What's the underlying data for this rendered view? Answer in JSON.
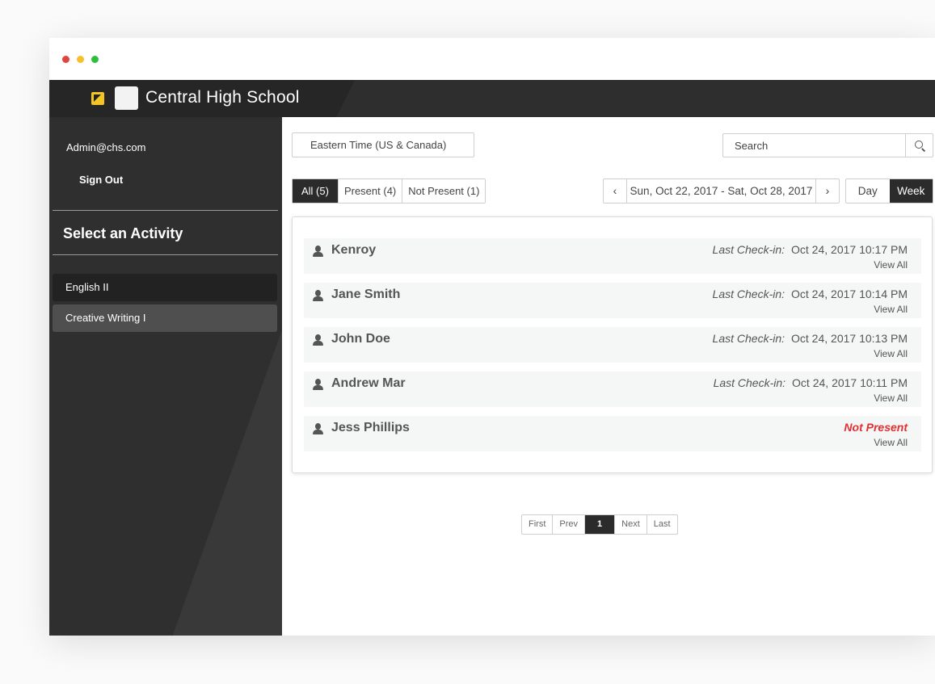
{
  "brand": {
    "title": "Central High School"
  },
  "sidebar": {
    "email": "Admin@chs.com",
    "sign_out": "Sign Out",
    "heading": "Select an Activity",
    "items": [
      {
        "label": "English II"
      },
      {
        "label": "Creative Writing I"
      }
    ]
  },
  "toolbar": {
    "timezone": "Eastern Time (US & Canada)",
    "search_placeholder": "Search",
    "filters": [
      {
        "label": "All (5)"
      },
      {
        "label": "Present (4)"
      },
      {
        "label": "Not Present (1)"
      }
    ],
    "date_range": "Sun, Oct 22, 2017 - Sat, Oct 28, 2017",
    "prev_glyph": "‹",
    "next_glyph": "›",
    "view_day": "Day",
    "view_week": "Week"
  },
  "attendance": [
    {
      "name": "Kenroy",
      "status_label": "Last Check-in:",
      "status_value": "Oct 24, 2017 10:17 PM",
      "view_all": "View All"
    },
    {
      "name": "Jane Smith",
      "status_label": "Last Check-in:",
      "status_value": "Oct 24, 2017 10:14 PM",
      "view_all": "View All"
    },
    {
      "name": "John Doe",
      "status_label": "Last Check-in:",
      "status_value": "Oct 24, 2017 10:13 PM",
      "view_all": "View All"
    },
    {
      "name": "Andrew Mar",
      "status_label": "Last Check-in:",
      "status_value": "Oct 24, 2017 10:11 PM",
      "view_all": "View All"
    },
    {
      "name": "Jess Phillips",
      "status_absent": "Not Present",
      "view_all": "View All"
    }
  ],
  "pagination": {
    "first": "First",
    "prev": "Prev",
    "current": "1",
    "next": "Next",
    "last": "Last"
  },
  "colors": {
    "accent": "#f3c623",
    "not_present": "#e3302f",
    "dark": "#2b2b2b"
  }
}
